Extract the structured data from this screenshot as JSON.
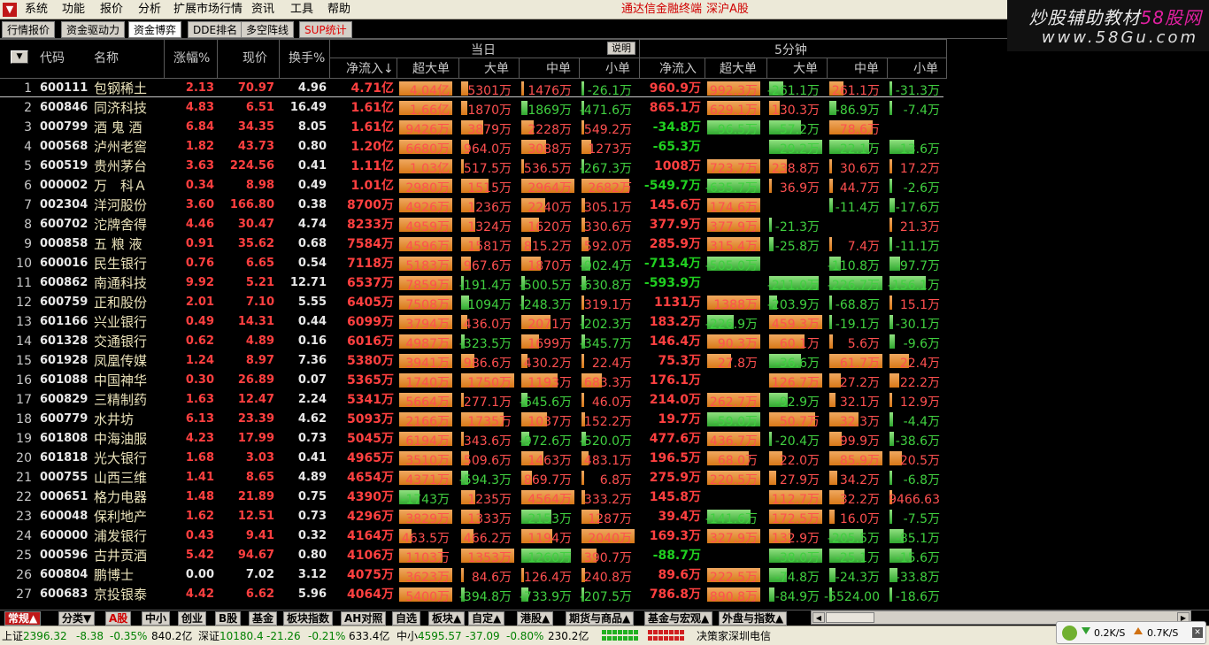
{
  "menu": {
    "items": [
      "系统",
      "功能",
      "报价",
      "分析",
      "扩展市场行情",
      "资讯",
      "工具",
      "帮助"
    ],
    "app_title": "通达信金融终端",
    "board": "深沪A股"
  },
  "watermark": {
    "text1": "炒股辅助教材",
    "text1b": "58股网",
    "text2": "www.58Gu.com"
  },
  "toptabs": [
    "行情报价",
    "资金驱动力",
    "资金博弈",
    "DDE排名",
    "多空阵线",
    "SUP统计"
  ],
  "header": {
    "code": "代码",
    "name": "名称",
    "chg": "涨幅%",
    "price": "现价",
    "turn": "换手%",
    "today": "当日",
    "five": "5分钟",
    "explain": "说明",
    "net": "净流入↓",
    "xl": "超大单",
    "l": "大单",
    "m": "中单",
    "s": "小单",
    "net5": "净流入",
    "xl5": "超大单",
    "l5": "大单",
    "m5": "中单",
    "s5": "小单"
  },
  "rows": [
    {
      "no": "1",
      "code": "600111",
      "name": "包钢稀土",
      "chg": "2.13",
      "price": "70.97",
      "turn": "4.96",
      "net": "4.71亿",
      "d": [
        [
          4.04,
          "4.04亿"
        ],
        [
          5301,
          "5301万"
        ],
        [
          1476,
          "1476万"
        ],
        [
          -26.1,
          "-26.1万"
        ]
      ],
      "net5": "960.9万",
      "f": [
        [
          992.3,
          "992.3万"
        ],
        [
          -261.1,
          "-261.1万"
        ],
        [
          261.1,
          "261.1万"
        ],
        [
          -31.3,
          "-31.3万"
        ]
      ]
    },
    {
      "no": "2",
      "code": "600846",
      "name": "同济科技",
      "chg": "4.83",
      "price": "6.51",
      "turn": "16.49",
      "net": "1.61亿",
      "d": [
        [
          1.66,
          "1.66亿"
        ],
        [
          1870,
          "1870万"
        ],
        [
          -1869,
          "-1869万"
        ],
        [
          -471.6,
          "-471.6万"
        ]
      ],
      "net5": "865.1万",
      "f": [
        [
          629.1,
          "629.1万"
        ],
        [
          130.3,
          "130.3万"
        ],
        [
          -86.9,
          "-86.9万"
        ],
        [
          -7.4,
          "-7.4万"
        ]
      ]
    },
    {
      "no": "3",
      "code": "000799",
      "name": "酒 鬼 酒",
      "chg": "6.84",
      "price": "34.35",
      "turn": "8.05",
      "net": "1.61亿",
      "d": [
        [
          9426,
          "9426万"
        ],
        [
          3879,
          "3879万"
        ],
        [
          2228,
          "2228万"
        ],
        [
          549.2,
          "549.2万"
        ]
      ],
      "net5": "-34.8万",
      "f": [
        [
          -96.5,
          "-96.5万"
        ],
        [
          -57.2,
          "-57.2万"
        ],
        [
          78.6,
          "78.6万"
        ],
        [
          0,
          ""
        ]
      ]
    },
    {
      "no": "4",
      "code": "000568",
      "name": "泸州老窖",
      "chg": "1.82",
      "price": "43.73",
      "turn": "0.80",
      "net": "1.20亿",
      "d": [
        [
          6680,
          "6680万"
        ],
        [
          964.0,
          "964.0万"
        ],
        [
          3088,
          "3088万"
        ],
        [
          1273,
          "1273万"
        ]
      ],
      "net5": "-65.3万",
      "f": [
        [
          0,
          ""
        ],
        [
          -29.2,
          "-29.2万"
        ],
        [
          -22.1,
          "-22.1万"
        ],
        [
          -13.6,
          "-13.6万"
        ]
      ]
    },
    {
      "no": "5",
      "code": "600519",
      "name": "贵州茅台",
      "chg": "3.63",
      "price": "224.56",
      "turn": "0.41",
      "net": "1.11亿",
      "d": [
        [
          1.03,
          "1.03亿"
        ],
        [
          517.5,
          "517.5万"
        ],
        [
          536.5,
          "536.5万"
        ],
        [
          -267.3,
          "-267.3万"
        ]
      ],
      "net5": "1008万",
      "f": [
        [
          723.7,
          "723.7万"
        ],
        [
          238.8,
          "238.8万"
        ],
        [
          30.6,
          "30.6万"
        ],
        [
          17.2,
          "17.2万"
        ]
      ]
    },
    {
      "no": "6",
      "code": "000002",
      "name": "万　科Ａ",
      "chg": "0.34",
      "price": "8.98",
      "turn": "0.49",
      "net": "1.01亿",
      "d": [
        [
          2980,
          "2980万"
        ],
        [
          1515,
          "1515万"
        ],
        [
          2964,
          "2964万"
        ],
        [
          2682,
          "2682万"
        ]
      ],
      "net5": "-549.7万",
      "f": [
        [
          -635.7,
          "-635.7万"
        ],
        [
          36.9,
          "36.9万"
        ],
        [
          44.7,
          "44.7万"
        ],
        [
          -2.6,
          "-2.6万"
        ]
      ]
    },
    {
      "no": "7",
      "code": "002304",
      "name": "洋河股份",
      "chg": "3.60",
      "price": "166.80",
      "turn": "0.38",
      "net": "8700万",
      "d": [
        [
          4926,
          "4926万"
        ],
        [
          1236,
          "1236万"
        ],
        [
          2240,
          "2240万"
        ],
        [
          305.1,
          "305.1万"
        ]
      ],
      "net5": "145.6万",
      "f": [
        [
          174.6,
          "174.6万"
        ],
        [
          0,
          ""
        ],
        [
          -11.4,
          "-11.4万"
        ],
        [
          -17.6,
          "-17.6万"
        ]
      ]
    },
    {
      "no": "8",
      "code": "600702",
      "name": "沱牌舍得",
      "chg": "4.46",
      "price": "30.47",
      "turn": "4.74",
      "net": "8233万",
      "d": [
        [
          4959,
          "4959万"
        ],
        [
          1324,
          "1324万"
        ],
        [
          1620,
          "1620万"
        ],
        [
          330.6,
          "330.6万"
        ]
      ],
      "net5": "377.9万",
      "f": [
        [
          377.9,
          "377.9万"
        ],
        [
          -21.3,
          "-21.3万"
        ],
        [
          0,
          ""
        ],
        [
          21.3,
          "21.3万"
        ]
      ]
    },
    {
      "no": "9",
      "code": "000858",
      "name": "五 粮 液",
      "chg": "0.91",
      "price": "35.62",
      "turn": "0.68",
      "net": "7584万",
      "d": [
        [
          4596,
          "4596万"
        ],
        [
          1581,
          "1581万"
        ],
        [
          815.2,
          "815.2万"
        ],
        [
          592.0,
          "592.0万"
        ]
      ],
      "net5": "285.9万",
      "f": [
        [
          315.4,
          "315.4万"
        ],
        [
          -25.8,
          "-25.8万"
        ],
        [
          7.4,
          "7.4万"
        ],
        [
          -11.1,
          "-11.1万"
        ]
      ]
    },
    {
      "no": "10",
      "code": "600016",
      "name": "民生银行",
      "chg": "0.76",
      "price": "6.65",
      "turn": "0.54",
      "net": "7118万",
      "d": [
        [
          5183,
          "5183万"
        ],
        [
          967.6,
          "967.6万"
        ],
        [
          1870,
          "1870万"
        ],
        [
          -902.4,
          "-902.4万"
        ]
      ],
      "net5": "-713.4万",
      "f": [
        [
          -505.0,
          "-505.0万"
        ],
        [
          0,
          ""
        ],
        [
          -110.8,
          "-110.8万"
        ],
        [
          -97.7,
          "-97.7万"
        ]
      ]
    },
    {
      "no": "11",
      "code": "600862",
      "name": "南通科技",
      "chg": "9.92",
      "price": "5.21",
      "turn": "12.71",
      "net": "6537万",
      "d": [
        [
          7859,
          "7859万"
        ],
        [
          -191.4,
          "-191.4万"
        ],
        [
          -500.5,
          "-500.5万"
        ],
        [
          -630.8,
          "-630.8万"
        ]
      ],
      "net5": "-593.9万",
      "f": [
        [
          0,
          ""
        ],
        [
          -211.0,
          "-211.0万"
        ],
        [
          -226.7,
          "-226.7万"
        ],
        [
          -156.1,
          "-156.1万"
        ]
      ]
    },
    {
      "no": "12",
      "code": "600759",
      "name": "正和股份",
      "chg": "2.01",
      "price": "7.10",
      "turn": "5.55",
      "net": "6405万",
      "d": [
        [
          7508,
          "7508万"
        ],
        [
          -1094,
          "-1094万"
        ],
        [
          -248.3,
          "-248.3万"
        ],
        [
          319.1,
          "319.1万"
        ]
      ],
      "net5": "1131万",
      "f": [
        [
          1388,
          "1388万"
        ],
        [
          -203.9,
          "-203.9万"
        ],
        [
          -68.8,
          "-68.8万"
        ],
        [
          15.1,
          "15.1万"
        ]
      ]
    },
    {
      "no": "13",
      "code": "601166",
      "name": "兴业银行",
      "chg": "0.49",
      "price": "14.31",
      "turn": "0.44",
      "net": "6099万",
      "d": [
        [
          3794,
          "3794万"
        ],
        [
          436.0,
          "436.0万"
        ],
        [
          2071,
          "2071万"
        ],
        [
          -202.3,
          "-202.3万"
        ]
      ],
      "net5": "183.2万",
      "f": [
        [
          -226.9,
          "-226.9万"
        ],
        [
          459.3,
          "459.3万"
        ],
        [
          -19.1,
          "-19.1万"
        ],
        [
          -30.1,
          "-30.1万"
        ]
      ]
    },
    {
      "no": "14",
      "code": "601328",
      "name": "交通银行",
      "chg": "0.62",
      "price": "4.89",
      "turn": "0.16",
      "net": "6016万",
      "d": [
        [
          4987,
          "4987万"
        ],
        [
          -323.5,
          "-323.5万"
        ],
        [
          1699,
          "1699万"
        ],
        [
          -345.7,
          "-345.7万"
        ]
      ],
      "net5": "146.4万",
      "f": [
        [
          90.3,
          "90.3万"
        ],
        [
          60.1,
          "60.1万"
        ],
        [
          5.6,
          "5.6万"
        ],
        [
          -9.6,
          "-9.6万"
        ]
      ]
    },
    {
      "no": "15",
      "code": "601928",
      "name": "凤凰传媒",
      "chg": "1.24",
      "price": "8.97",
      "turn": "7.36",
      "net": "5380万",
      "d": [
        [
          3941,
          "3941万"
        ],
        [
          986.6,
          "986.6万"
        ],
        [
          430.2,
          "430.2万"
        ],
        [
          22.4,
          "22.4万"
        ]
      ],
      "net5": "75.3万",
      "f": [
        [
          27.8,
          "27.8万"
        ],
        [
          -36.6,
          "-36.6万"
        ],
        [
          61.7,
          "61.7万"
        ],
        [
          22.4,
          "22.4万"
        ]
      ]
    },
    {
      "no": "16",
      "code": "601088",
      "name": "中国神华",
      "chg": "0.30",
      "price": "26.89",
      "turn": "0.07",
      "net": "5365万",
      "d": [
        [
          1740,
          "1740万"
        ],
        [
          1750,
          "1750万"
        ],
        [
          1193,
          "1193万"
        ],
        [
          683.3,
          "683.3万"
        ]
      ],
      "net5": "176.1万",
      "f": [
        [
          0,
          ""
        ],
        [
          126.7,
          "126.7万"
        ],
        [
          27.2,
          "27.2万"
        ],
        [
          22.2,
          "22.2万"
        ]
      ]
    },
    {
      "no": "17",
      "code": "600829",
      "name": "三精制药",
      "chg": "1.63",
      "price": "12.47",
      "turn": "2.24",
      "net": "5341万",
      "d": [
        [
          5664,
          "5664万"
        ],
        [
          277.1,
          "277.1万"
        ],
        [
          -645.6,
          "-645.6万"
        ],
        [
          46.0,
          "46.0万"
        ]
      ],
      "net5": "214.0万",
      "f": [
        [
          262.7,
          "262.7万"
        ],
        [
          -92.9,
          "-92.9万"
        ],
        [
          32.1,
          "32.1万"
        ],
        [
          12.9,
          "12.9万"
        ]
      ]
    },
    {
      "no": "18",
      "code": "600779",
      "name": "水井坊",
      "chg": "6.13",
      "price": "23.39",
      "turn": "4.62",
      "net": "5093万",
      "d": [
        [
          2166,
          "2166万"
        ],
        [
          1735,
          "1735万"
        ],
        [
          1037,
          "1037万"
        ],
        [
          152.2,
          "152.2万"
        ]
      ],
      "net5": "19.7万",
      "f": [
        [
          -59.0,
          "-59.0万"
        ],
        [
          50.7,
          "50.7万"
        ],
        [
          32.3,
          "32.3万"
        ],
        [
          -4.4,
          "-4.4万"
        ]
      ]
    },
    {
      "no": "19",
      "code": "601808",
      "name": "中海油服",
      "chg": "4.23",
      "price": "17.99",
      "turn": "0.73",
      "net": "5045万",
      "d": [
        [
          6194,
          "6194万"
        ],
        [
          343.6,
          "343.6万"
        ],
        [
          -972.6,
          "-972.6万"
        ],
        [
          -520.0,
          "-520.0万"
        ]
      ],
      "net5": "477.6万",
      "f": [
        [
          436.7,
          "436.7万"
        ],
        [
          -20.4,
          "-20.4万"
        ],
        [
          99.9,
          "99.9万"
        ],
        [
          -38.6,
          "-38.6万"
        ]
      ]
    },
    {
      "no": "20",
      "code": "601818",
      "name": "光大银行",
      "chg": "1.68",
      "price": "3.03",
      "turn": "0.41",
      "net": "4965万",
      "d": [
        [
          3510,
          "3510万"
        ],
        [
          509.6,
          "509.6万"
        ],
        [
          1463,
          "1463万"
        ],
        [
          483.1,
          "483.1万"
        ]
      ],
      "net5": "196.5万",
      "f": [
        [
          68.0,
          "68.0万"
        ],
        [
          22.0,
          "22.0万"
        ],
        [
          85.9,
          "85.9万"
        ],
        [
          20.5,
          "20.5万"
        ]
      ]
    },
    {
      "no": "21",
      "code": "000755",
      "name": "山西三维",
      "chg": "1.41",
      "price": "8.65",
      "turn": "4.89",
      "net": "4654万",
      "d": [
        [
          4371,
          "4371万"
        ],
        [
          -594.3,
          "-594.3万"
        ],
        [
          869.7,
          "869.7万"
        ],
        [
          6.8,
          "6.8万"
        ]
      ],
      "net5": "275.9万",
      "f": [
        [
          220.5,
          "220.5万"
        ],
        [
          27.9,
          "27.9万"
        ],
        [
          34.2,
          "34.2万"
        ],
        [
          -6.8,
          "-6.8万"
        ]
      ]
    },
    {
      "no": "22",
      "code": "000651",
      "name": "格力电器",
      "chg": "1.48",
      "price": "21.89",
      "turn": "0.75",
      "net": "4390万",
      "d": [
        [
          -1743,
          "-1743万"
        ],
        [
          1235,
          "1235万"
        ],
        [
          4564,
          "4564万"
        ],
        [
          333.2,
          "333.2万"
        ]
      ],
      "net5": "145.8万",
      "f": [
        [
          0,
          ""
        ],
        [
          112.7,
          "112.7万"
        ],
        [
          32.2,
          "32.2万"
        ],
        [
          9466.63,
          "9466.63"
        ]
      ]
    },
    {
      "no": "23",
      "code": "600048",
      "name": "保利地产",
      "chg": "1.62",
      "price": "12.51",
      "turn": "0.73",
      "net": "4296万",
      "d": [
        [
          3829,
          "3829万"
        ],
        [
          1333,
          "1333万"
        ],
        [
          -2153,
          "-2153万"
        ],
        [
          1287,
          "1287万"
        ]
      ],
      "net5": "39.4万",
      "f": [
        [
          -141.6,
          "-141.6万"
        ],
        [
          172.5,
          "172.5万"
        ],
        [
          16.0,
          "16.0万"
        ],
        [
          -7.5,
          "-7.5万"
        ]
      ]
    },
    {
      "no": "24",
      "code": "600000",
      "name": "浦发银行",
      "chg": "0.43",
      "price": "9.41",
      "turn": "0.32",
      "net": "4164万",
      "d": [
        [
          463.5,
          "463.5万"
        ],
        [
          466.2,
          "466.2万"
        ],
        [
          1194,
          "1194万"
        ],
        [
          2040,
          "2040万"
        ]
      ],
      "net5": "169.3万",
      "f": [
        [
          327.9,
          "327.9万"
        ],
        [
          132.9,
          "132.9万"
        ],
        [
          -205.5,
          "-205.5万"
        ],
        [
          -85.1,
          "-85.1万"
        ]
      ]
    },
    {
      "no": "25",
      "code": "000596",
      "name": "古井贡酒",
      "chg": "5.42",
      "price": "94.67",
      "turn": "0.80",
      "net": "4106万",
      "d": [
        [
          1103,
          "1103万"
        ],
        [
          1353,
          "1353万"
        ],
        [
          -1260,
          "-1260万"
        ],
        [
          390.7,
          "390.7万"
        ]
      ],
      "net5": "-88.7万",
      "f": [
        [
          0,
          ""
        ],
        [
          -38.0,
          "-38.0万"
        ],
        [
          -25.1,
          "-25.1万"
        ],
        [
          -15.6,
          "-15.6万"
        ]
      ]
    },
    {
      "no": "26",
      "code": "600804",
      "name": "鹏博士",
      "chg": "0.00",
      "price": "7.02",
      "turn": "3.12",
      "net": "4075万",
      "d": [
        [
          3623,
          "3623万"
        ],
        [
          84.6,
          "84.6万"
        ],
        [
          126.4,
          "126.4万"
        ],
        [
          240.8,
          "240.8万"
        ]
      ],
      "net5": "89.6万",
      "f": [
        [
          222.5,
          "222.5万"
        ],
        [
          -74.8,
          "-74.8万"
        ],
        [
          -24.3,
          "-24.3万"
        ],
        [
          -33.8,
          "-33.8万"
        ]
      ]
    },
    {
      "no": "27",
      "code": "600683",
      "name": "京投银泰",
      "chg": "4.42",
      "price": "6.62",
      "turn": "5.96",
      "net": "4064万",
      "d": [
        [
          5400,
          "5400万"
        ],
        [
          -394.8,
          "-394.8万"
        ],
        [
          -733.9,
          "-733.9万"
        ],
        [
          -207.5,
          "-207.5万"
        ]
      ],
      "net5": "786.8万",
      "f": [
        [
          890.8,
          "890.8万"
        ],
        [
          -84.9,
          "-84.9万"
        ],
        [
          -5524.0,
          "-5524.00"
        ],
        [
          -18.6,
          "-18.6万"
        ]
      ]
    }
  ],
  "bottomtabs": [
    "常规▲",
    "分类▼",
    "A股",
    "中小",
    "创业",
    "B股",
    "基金",
    "板块指数",
    "AH对照",
    "自选",
    "板块▲",
    "自定▲",
    "港股▲",
    "期货与商品▲",
    "基金与宏观▲",
    "外盘与指数▲"
  ],
  "status": {
    "sh_label": "上证",
    "sh_val": "2396.32",
    "sh_chg": "-8.38",
    "sh_pct": "-0.35%",
    "sh_amt": "840.2亿",
    "sz_label": "深证",
    "sz_val": "10180.4",
    "sz_chg": "-21.26",
    "sz_pct": "-0.21%",
    "sz_amt": "633.4亿",
    "zx_label": "中小",
    "zx_val": "4595.57",
    "zx_chg": "-37.09",
    "zx_pct": "-0.80%",
    "zx_amt": "230.2亿",
    "broker": "决策家深圳电信",
    "down": "0.2K/S",
    "up": "0.7K/S"
  },
  "colors": {
    "pos": "#e08020",
    "neg": "#40c040",
    "up": "#ff4040",
    "down": "#20d020"
  }
}
